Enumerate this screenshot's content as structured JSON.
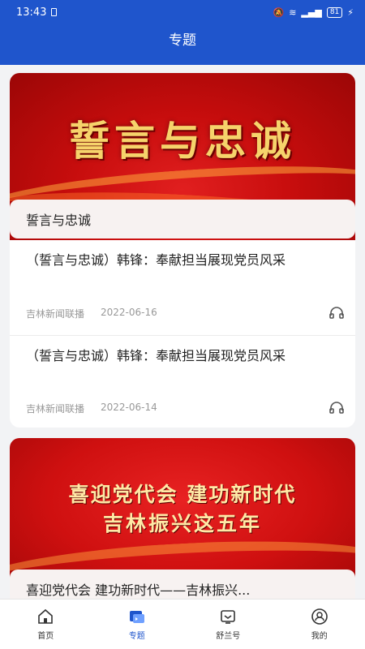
{
  "status": {
    "time": "13:43",
    "battery": "81"
  },
  "header": {
    "title": "专题"
  },
  "topics": [
    {
      "banner_text": "誓言与忠诚",
      "name": "誓言与忠诚",
      "items": [
        {
          "title": "（誓言与忠诚）韩锋：奉献担当展现党员风采",
          "source": "吉林新闻联播",
          "date": "2022-06-16"
        },
        {
          "title": "（誓言与忠诚）韩锋：奉献担当展现党员风采",
          "source": "吉林新闻联播",
          "date": "2022-06-14"
        }
      ]
    },
    {
      "banner_line1": "喜迎党代会  建功新时代",
      "banner_line2": "吉林振兴这五年",
      "name": "喜迎党代会 建功新时代——吉林振兴..."
    }
  ],
  "nav": [
    {
      "label": "首页",
      "icon": "home-icon",
      "active": false
    },
    {
      "label": "专题",
      "icon": "topic-icon",
      "active": true
    },
    {
      "label": "舒兰号",
      "icon": "channel-icon",
      "active": false
    },
    {
      "label": "我的",
      "icon": "profile-icon",
      "active": false
    }
  ],
  "colors": {
    "primary": "#1f55cc",
    "banner_red": "#d01010",
    "banner_gold": "#f6d36b"
  }
}
